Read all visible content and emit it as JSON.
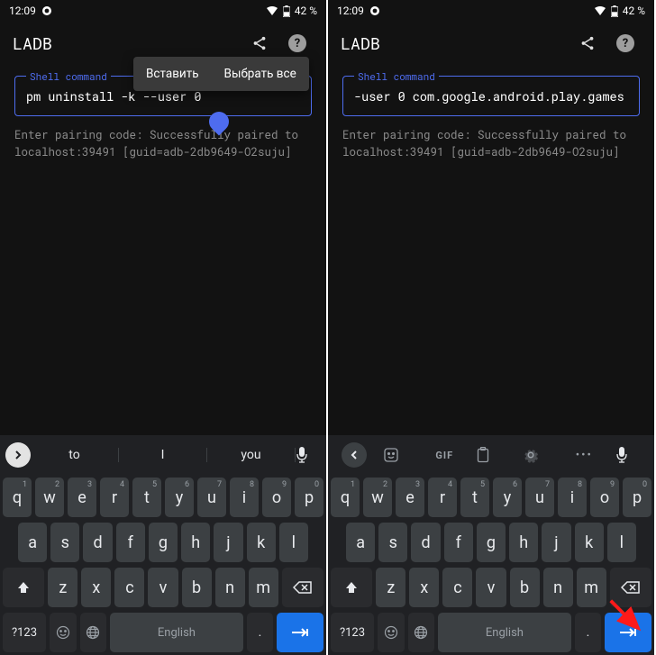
{
  "status": {
    "time": "12:09",
    "battery": "42 %"
  },
  "app": {
    "title": "LADB"
  },
  "left": {
    "legend": "Shell command",
    "command": "pm uninstall -k --user 0",
    "output": "Enter pairing code: Successfully paired to localhost:39491 [guid=adb-2db9649-O2suju]",
    "context_menu": {
      "paste": "Вставить",
      "select_all": "Выбрать все"
    },
    "suggestions": [
      "to",
      "I",
      "you"
    ]
  },
  "right": {
    "legend": "Shell command",
    "command": "-user 0 com.google.android.play.games",
    "output": "Enter pairing code: Successfully paired to localhost:39491 [guid=adb-2db9649-O2suju]",
    "toolbar": {
      "gif": "GIF"
    }
  },
  "keyboard": {
    "row1": [
      {
        "k": "q",
        "n": "1"
      },
      {
        "k": "w",
        "n": "2"
      },
      {
        "k": "e",
        "n": "3"
      },
      {
        "k": "r",
        "n": "4"
      },
      {
        "k": "t",
        "n": "5"
      },
      {
        "k": "y",
        "n": "6"
      },
      {
        "k": "u",
        "n": "7"
      },
      {
        "k": "i",
        "n": "8"
      },
      {
        "k": "o",
        "n": "9"
      },
      {
        "k": "p",
        "n": "0"
      }
    ],
    "row2": [
      "a",
      "s",
      "d",
      "f",
      "g",
      "h",
      "j",
      "k",
      "l"
    ],
    "row3": [
      "z",
      "x",
      "c",
      "v",
      "b",
      "n",
      "m"
    ],
    "symbols": "?123",
    "space": "English",
    "period": "."
  }
}
